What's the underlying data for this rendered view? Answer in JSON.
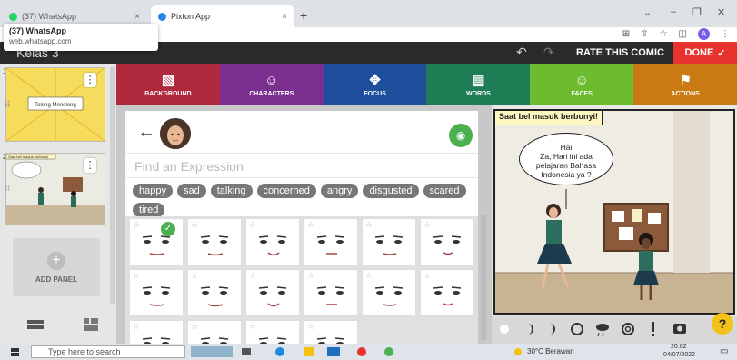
{
  "browser": {
    "tabs": [
      {
        "title": "(37) WhatsApp",
        "favicon_color": "#25d366"
      },
      {
        "title": "Pixton App",
        "favicon_color": "#2a86e8"
      }
    ],
    "tab_close": "×",
    "new_tab": "+",
    "window_controls": [
      "⌄",
      "–",
      "❐",
      "✕"
    ]
  },
  "tooltip": {
    "title": "(37) WhatsApp",
    "url": "web.whatsapp.com"
  },
  "app": {
    "title": "Kelas 3",
    "rate_label": "RATE THIS COMIC",
    "done_label": "DONE"
  },
  "categories": [
    {
      "label": "BACKGROUND",
      "icon": "image-icon",
      "glyph": "▧",
      "color": "#b02a3e"
    },
    {
      "label": "CHARACTERS",
      "icon": "face-icon",
      "glyph": "☺",
      "color": "#7b2f8e"
    },
    {
      "label": "FOCUS",
      "icon": "focus-icon",
      "glyph": "✥",
      "color": "#1f4f9c"
    },
    {
      "label": "WORDS",
      "icon": "speech-icon",
      "glyph": "▤",
      "color": "#1e7d55"
    },
    {
      "label": "FACES",
      "icon": "smile-icon",
      "glyph": "☺",
      "color": "#6dbb2e"
    },
    {
      "label": "ACTIONS",
      "icon": "run-icon",
      "glyph": "🏃",
      "color": "#c97a12"
    }
  ],
  "panels": [
    {
      "number": "1",
      "caption": "Tolong Menolong"
    },
    {
      "number": "2",
      "caption": "Saat bel masuk berbunyi"
    }
  ],
  "add_panel_label": "ADD PANEL",
  "chooser": {
    "search_placeholder": "Find an Expression",
    "tags": [
      "happy",
      "sad",
      "talking",
      "concerned",
      "angry",
      "disgusted",
      "scared",
      "tired"
    ]
  },
  "comic": {
    "caption": "Saat bel masuk berbunyi!",
    "bubble": [
      "Hai",
      "Za, Hari ini ada",
      "pelajaran Bahasa",
      "Indonesia ya ?"
    ]
  },
  "help_label": "?",
  "taskbar": {
    "search_placeholder": "Type here to search",
    "weather": "30°C  Berawan",
    "time": "20:02",
    "date": "04/07/2022"
  }
}
